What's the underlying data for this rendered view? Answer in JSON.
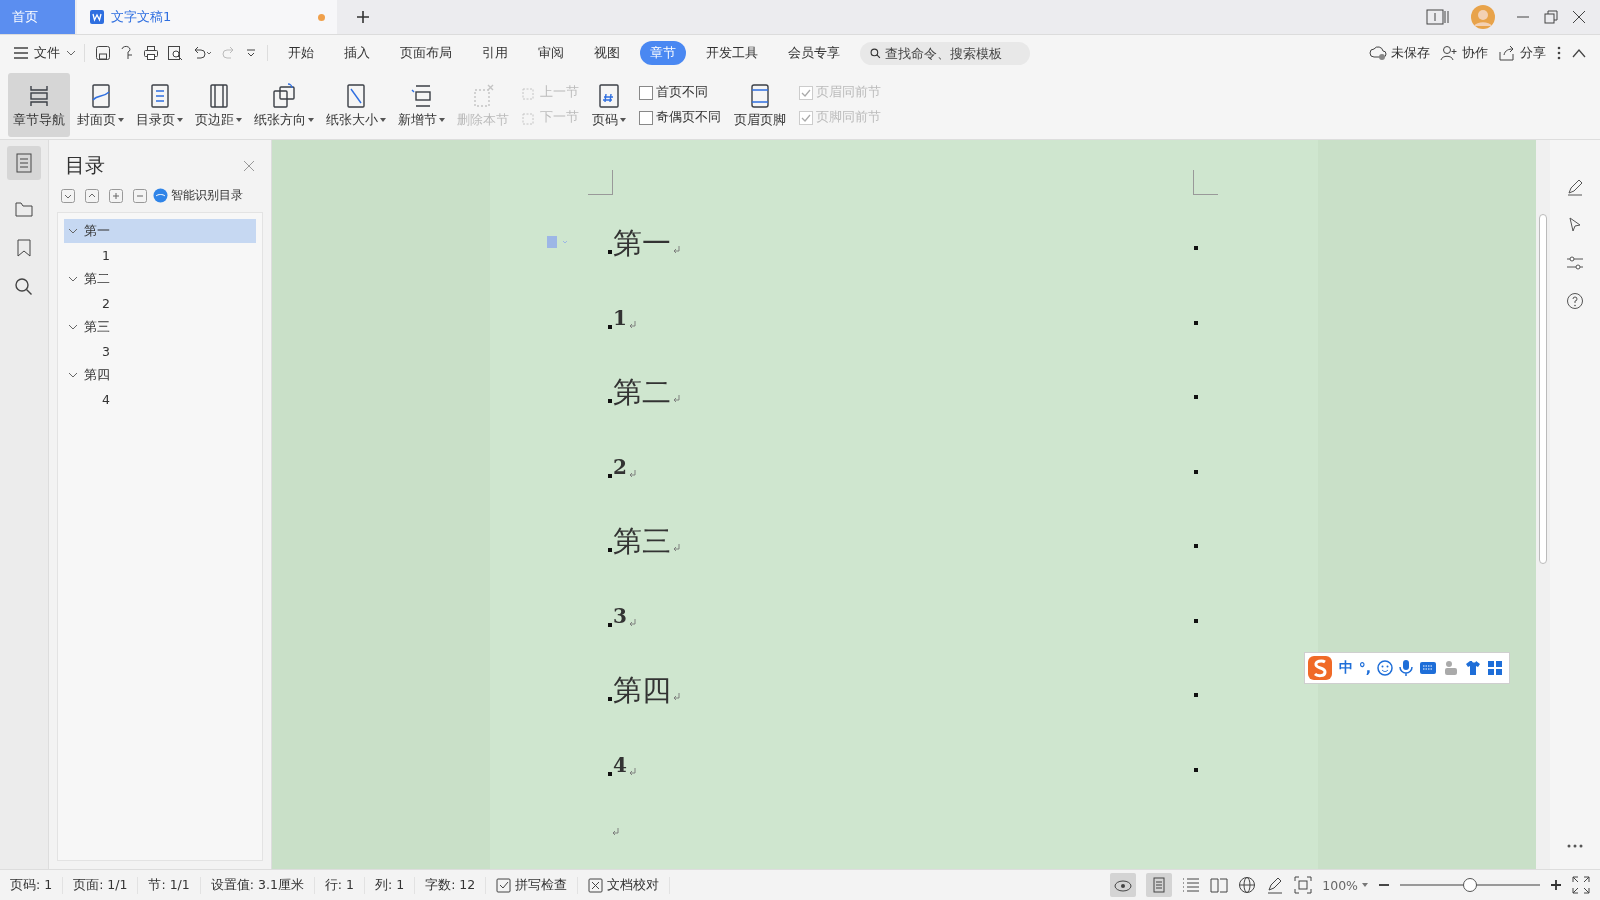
{
  "tabs": [
    {
      "label": "首页",
      "kind": "home",
      "selected": false
    },
    {
      "label": "文字文稿1",
      "kind": "doc",
      "selected": true,
      "unsaved": true
    }
  ],
  "menu": {
    "file": "文件",
    "items": [
      {
        "label": "开始",
        "selected": false
      },
      {
        "label": "插入",
        "selected": false
      },
      {
        "label": "页面布局",
        "selected": false
      },
      {
        "label": "引用",
        "selected": false
      },
      {
        "label": "审阅",
        "selected": false
      },
      {
        "label": "视图",
        "selected": false
      },
      {
        "label": "章节",
        "selected": true
      },
      {
        "label": "开发工具",
        "selected": false
      },
      {
        "label": "会员专享",
        "selected": false
      }
    ],
    "search": {
      "placeholder": "查找命令、搜索模板"
    },
    "actions": [
      {
        "label": "未保存",
        "kind": "cloud"
      },
      {
        "label": "协作",
        "kind": "user"
      },
      {
        "label": "分享",
        "kind": "share"
      }
    ]
  },
  "ribbon": [
    {
      "kind": "big",
      "label": "章节导航",
      "caret": false,
      "disabled": false,
      "selected": true
    },
    {
      "kind": "big",
      "label": "封面页",
      "caret": true,
      "disabled": false,
      "selected": false
    },
    {
      "kind": "big",
      "label": "目录页",
      "caret": true,
      "disabled": false,
      "selected": false
    },
    {
      "kind": "big",
      "label": "页边距",
      "caret": true,
      "disabled": false,
      "selected": false
    },
    {
      "kind": "big",
      "label": "纸张方向",
      "caret": true,
      "disabled": false,
      "selected": false
    },
    {
      "kind": "big",
      "label": "纸张大小",
      "caret": true,
      "disabled": false,
      "selected": false
    },
    {
      "kind": "big",
      "label": "新增节",
      "caret": true,
      "disabled": false,
      "selected": false
    },
    {
      "kind": "big",
      "label": "删除本节",
      "caret": false,
      "disabled": true,
      "selected": false
    },
    {
      "kind": "pair",
      "items": [
        {
          "label": "上一节",
          "disabled": true
        },
        {
          "label": "下一节",
          "disabled": true
        }
      ]
    },
    {
      "kind": "big",
      "label": "页码",
      "caret": true,
      "disabled": false,
      "selected": false
    },
    {
      "kind": "checks",
      "items": [
        {
          "label": "首页不同",
          "checked": false,
          "disabled": false
        },
        {
          "label": "奇偶页不同",
          "checked": false,
          "disabled": false
        }
      ]
    },
    {
      "kind": "big",
      "label": "页眉页脚",
      "caret": false,
      "disabled": false,
      "selected": false
    },
    {
      "kind": "checks",
      "items": [
        {
          "label": "页眉同前节",
          "checked": true,
          "disabled": true
        },
        {
          "label": "页脚同前节",
          "checked": true,
          "disabled": true
        }
      ]
    }
  ],
  "sidebar": {
    "title": "目录",
    "smart": "智能识别目录",
    "tree": [
      {
        "label": "第一",
        "expanded": true,
        "selected": true,
        "children": [
          {
            "label": "1",
            "selected": false
          }
        ]
      },
      {
        "label": "第二",
        "expanded": true,
        "selected": false,
        "children": [
          {
            "label": "2",
            "selected": false
          }
        ]
      },
      {
        "label": "第三",
        "expanded": true,
        "selected": false,
        "children": [
          {
            "label": "3",
            "selected": false
          }
        ]
      },
      {
        "label": "第四",
        "expanded": true,
        "selected": false,
        "children": [
          {
            "label": "4",
            "selected": false
          }
        ]
      }
    ]
  },
  "document": {
    "paragraphs": [
      {
        "text": "第一",
        "kind": "heading"
      },
      {
        "text": "1",
        "kind": "number"
      },
      {
        "text": "第二",
        "kind": "heading"
      },
      {
        "text": "2",
        "kind": "number"
      },
      {
        "text": "第三",
        "kind": "heading"
      },
      {
        "text": "3",
        "kind": "number"
      },
      {
        "text": "第四",
        "kind": "heading"
      },
      {
        "text": "4",
        "kind": "number"
      }
    ]
  },
  "ime": {
    "mode": "中",
    "punct": "°,"
  },
  "status_bar": {
    "items": [
      "页码: 1",
      "页面: 1/1",
      "节: 1/1",
      "设置值: 3.1厘米",
      "行: 1",
      "列: 1",
      "字数: 12"
    ],
    "tools": [
      {
        "label": "拼写检查",
        "kind": "check"
      },
      {
        "label": "文档校对",
        "kind": "cross"
      }
    ],
    "zoom": "100%",
    "level": 0.5
  }
}
